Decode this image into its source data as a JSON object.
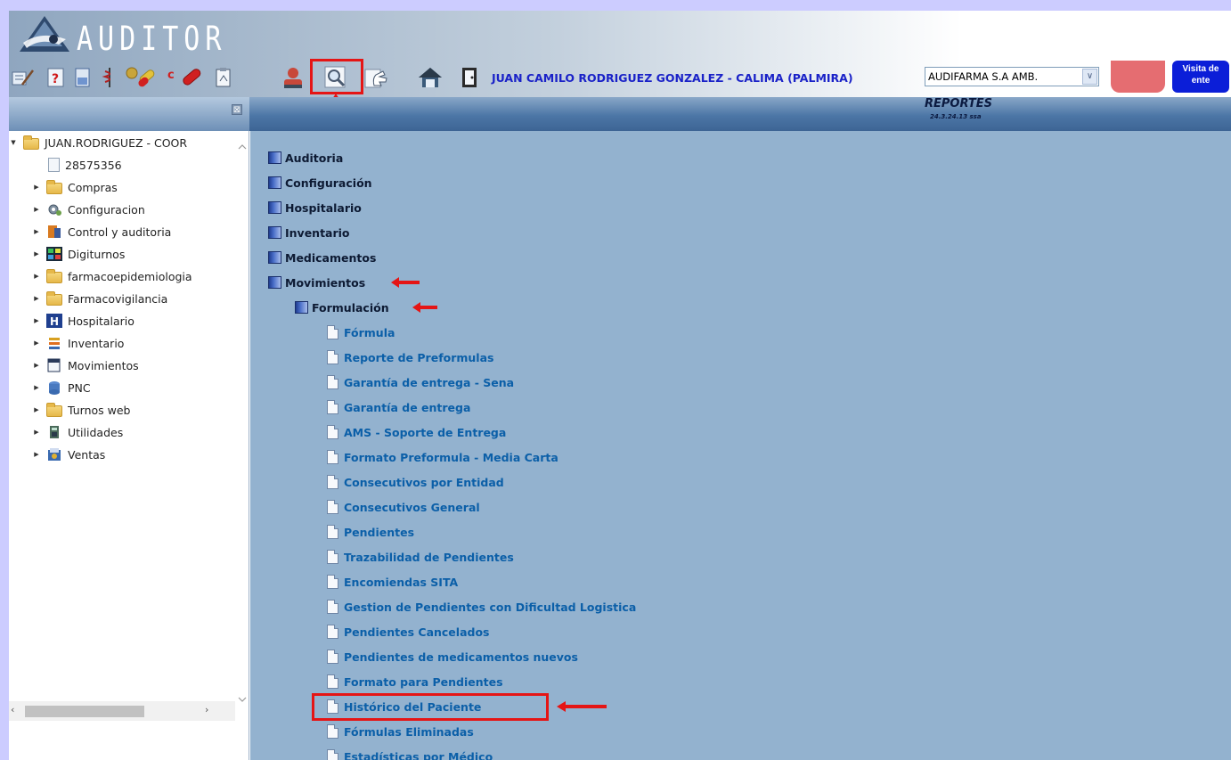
{
  "app": {
    "logo_text": "AUDITOR"
  },
  "toolbar": {
    "user_name": "JUAN CAMILO RODRIGUEZ GONZALEZ - CALIMA (PALMIRA)",
    "entity_value": "AUDIFARMA S.A AMB.",
    "visita_line1": "Visita de",
    "visita_line2": "ente",
    "icons": [
      "edit-icon",
      "help-icon",
      "document-icon",
      "medical-icon",
      "pills-icon",
      "capsule-icon",
      "clipboard-icon",
      "user-icon",
      "search-icon",
      "hand-icon",
      "home-icon",
      "exit-icon"
    ]
  },
  "header_bar": {
    "title": "REPORTES",
    "version": "24.3.24.13 ssa",
    "collapse_label": "⊠"
  },
  "sidebar": {
    "root": "JUAN.RODRIGUEZ - COOR",
    "id_item": "28575356",
    "items": [
      {
        "label": "Compras",
        "icon": "folder"
      },
      {
        "label": "Configuracion",
        "icon": "gear"
      },
      {
        "label": "Control y auditoria",
        "icon": "audit"
      },
      {
        "label": "Digiturnos",
        "icon": "digiturnos"
      },
      {
        "label": "farmacoepidemiologia",
        "icon": "folder"
      },
      {
        "label": "Farmacovigilancia",
        "icon": "folder"
      },
      {
        "label": "Hospitalario",
        "icon": "hospital"
      },
      {
        "label": "Inventario",
        "icon": "inventory"
      },
      {
        "label": "Movimientos",
        "icon": "movements"
      },
      {
        "label": "PNC",
        "icon": "pnc"
      },
      {
        "label": "Turnos web",
        "icon": "folder"
      },
      {
        "label": "Utilidades",
        "icon": "utilities"
      },
      {
        "label": "Ventas",
        "icon": "sales"
      }
    ]
  },
  "main": {
    "categories": [
      "Auditoria",
      "Configuración",
      "Hospitalario",
      "Inventario",
      "Medicamentos",
      "Movimientos"
    ],
    "subcategory": "Formulación",
    "reports": [
      "Fórmula",
      "Reporte de Preformulas",
      "Garantía de entrega - Sena",
      "Garantía de entrega",
      "AMS - Soporte de Entrega",
      "Formato Preformula - Media Carta",
      "Consecutivos por Entidad",
      "Consecutivos General",
      "Pendientes",
      "Trazabilidad de Pendientes",
      "Encomiendas SITA",
      "Gestion de Pendientes con Dificultad Logistica",
      "Pendientes Cancelados",
      "Pendientes de medicamentos nuevos",
      "Formato para Pendientes",
      "Histórico del Paciente",
      "Fórmulas Eliminadas",
      "Estadísticas por Médico"
    ]
  },
  "colors": {
    "accent_red": "#e51515",
    "user_blue": "#1a22c8",
    "link_blue": "#0b5fa8",
    "main_bg": "#93b2cf"
  }
}
